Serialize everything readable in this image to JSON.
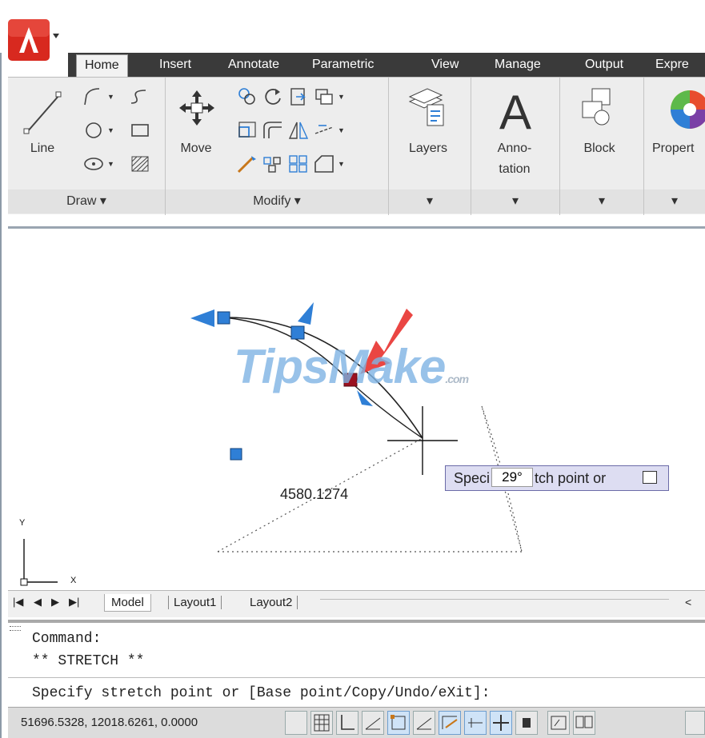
{
  "ribbon": {
    "tabs": [
      "Home",
      "Insert",
      "Annotate",
      "Parametric",
      "View",
      "Manage",
      "Output",
      "Expre"
    ],
    "panels": {
      "draw": {
        "title": "Draw ▾",
        "line_label": "Line"
      },
      "modify": {
        "title": "Modify ▾",
        "move_label": "Move"
      },
      "layers": {
        "label": "Layers",
        "arrow": "▾"
      },
      "annotation": {
        "label1": "Anno-",
        "label2": "tation",
        "arrow": "▾"
      },
      "block": {
        "label": "Block",
        "arrow": "▾"
      },
      "properties": {
        "label": "Propert",
        "arrow": "▾"
      }
    }
  },
  "canvas": {
    "watermark": "TipsMake",
    "watermark_suffix": ".com",
    "dimension_label": "4580.1274",
    "tooltip_text": "Speci",
    "tooltip_text2": "tch point or",
    "angle_value": "29°",
    "ucs_y": "Y",
    "ucs_x": "X"
  },
  "layout_tabs": [
    "Model",
    "Layout1",
    "Layout2"
  ],
  "command": {
    "line1": "Command:",
    "line2": "** STRETCH **",
    "prompt": "Specify stretch point or [Base point/Copy/Undo/eXit]:"
  },
  "status": {
    "coords": "51696.5328, 12018.6261, 0.0000"
  },
  "colors": {
    "accent_red": "#e8322f",
    "grip_blue": "#2f7fd6",
    "grip_hot": "#9b1120",
    "tabbar": "#3a3a3a"
  }
}
